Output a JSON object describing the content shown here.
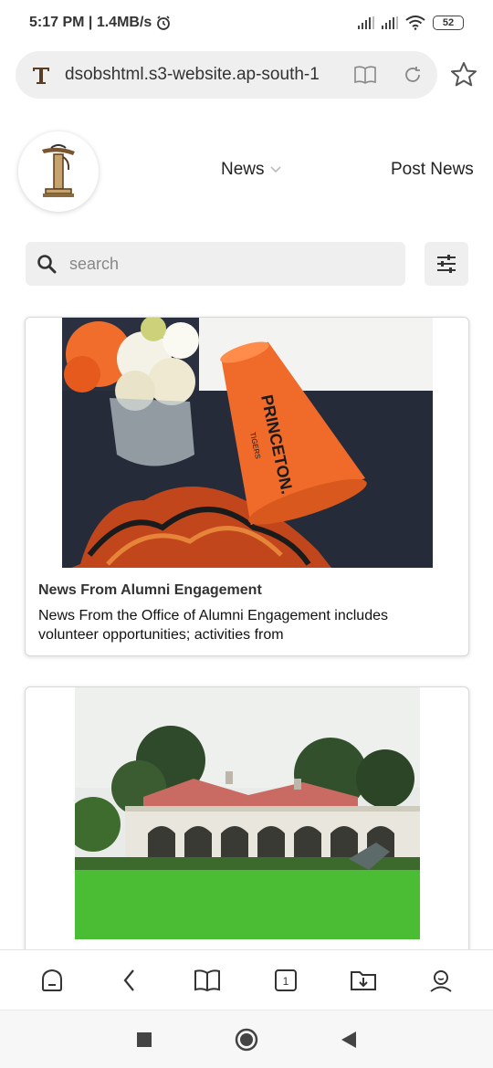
{
  "status": {
    "time_speed": "5:17 PM | 1.4MB/s",
    "battery": "52"
  },
  "browser": {
    "url": "dsobshtml.s3-website.ap-south-1",
    "tab_count": "1"
  },
  "nav": {
    "news": "News",
    "post_news": "Post News"
  },
  "search": {
    "placeholder": "search"
  },
  "cards": [
    {
      "title": "News From Alumni Engagement",
      "description": "News From the Office of Alumni Engagement includes volunteer opportunities; activities from",
      "image_text": "PRINCETON.",
      "image_subtext": "TIGERS"
    },
    {
      "title": "",
      "description": ""
    }
  ],
  "colors": {
    "accent_orange": "#f06a2a",
    "background": "#ffffff",
    "field_gray": "#efefef"
  }
}
